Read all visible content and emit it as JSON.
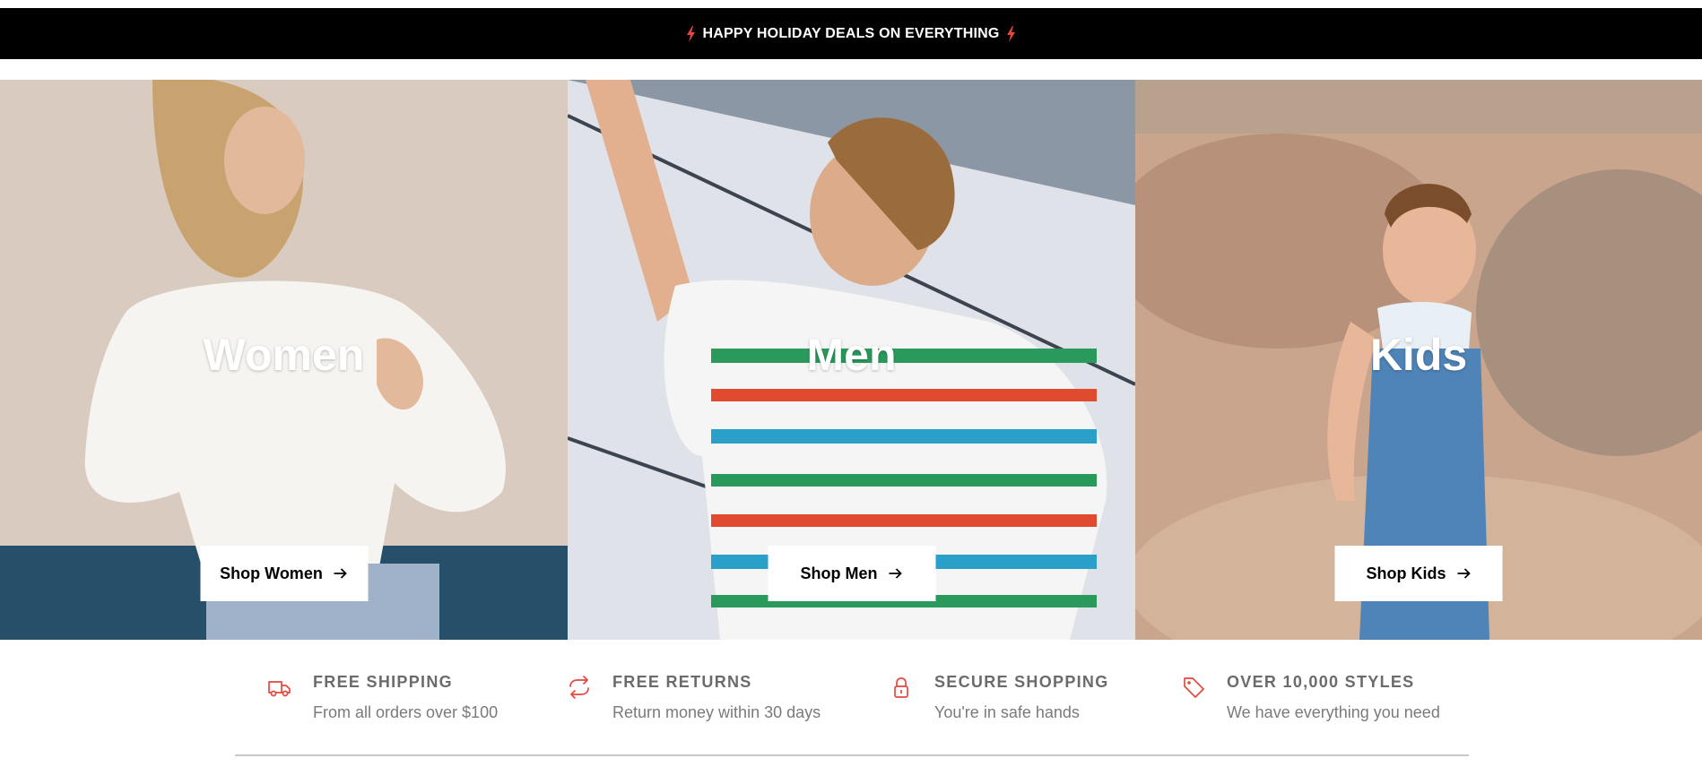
{
  "announcement": {
    "text": "HAPPY HOLIDAY DEALS ON EVERYTHING",
    "icon": "lightning-bolt-icon",
    "icon_color": "#e8463c"
  },
  "categories": [
    {
      "title": "Women",
      "button_label": "Shop Women",
      "button_icon": "arrow-right-icon"
    },
    {
      "title": "Men",
      "button_label": "Shop Men",
      "button_icon": "arrow-right-icon"
    },
    {
      "title": "Kids",
      "button_label": "Shop Kids",
      "button_icon": "arrow-right-icon"
    }
  ],
  "features": [
    {
      "icon": "truck-icon",
      "title": "FREE SHIPPING",
      "subtitle": "From all orders over $100"
    },
    {
      "icon": "refresh-icon",
      "title": "FREE RETURNS",
      "subtitle": "Return money within 30 days"
    },
    {
      "icon": "lock-icon",
      "title": "SECURE SHOPPING",
      "subtitle": "You're in safe hands"
    },
    {
      "icon": "tag-icon",
      "title": "OVER 10,000 STYLES",
      "subtitle": "We have everything you need"
    }
  ],
  "colors": {
    "accent": "#e8463c",
    "announcement_bg": "#000000",
    "feature_title": "#6b6b6b",
    "feature_subtitle": "#7a7a7a"
  }
}
